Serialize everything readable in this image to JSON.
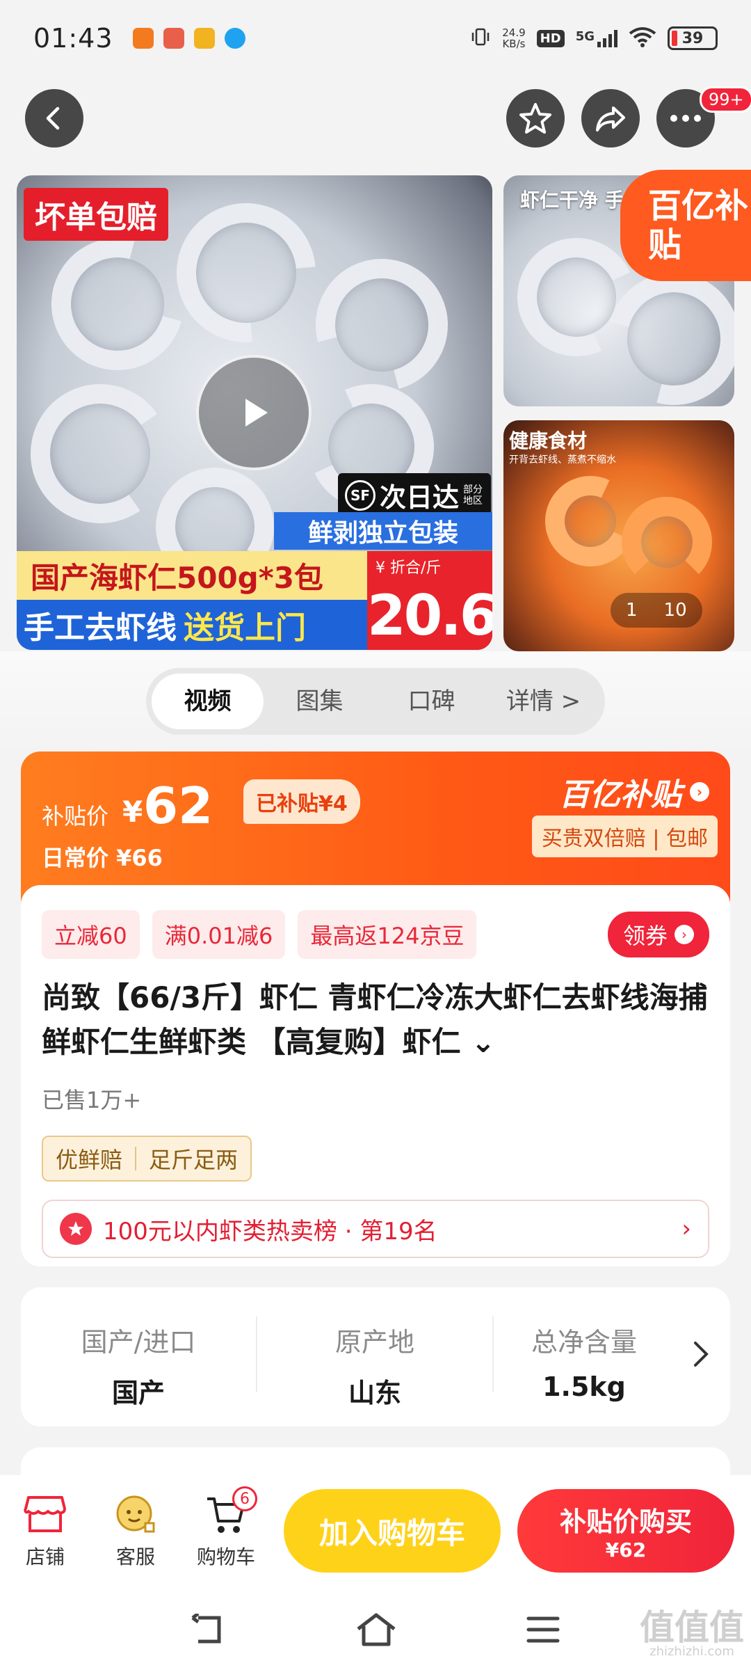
{
  "status_bar": {
    "time": "01:43",
    "speed_value": "24.9",
    "speed_unit": "KB/s",
    "hd": "HD",
    "network": "5G",
    "battery": "39"
  },
  "top_nav": {
    "more_badge": "99+"
  },
  "gallery": {
    "main": {
      "tag": "坏单包赔",
      "sf_label": "次日达",
      "sf_note": "部分地区",
      "blue_banner": "鲜剥独立包装",
      "yellow_banner": "国产海虾仁500g*3包",
      "blue_banner2_a": "手工去虾线",
      "blue_banner2_b": "送货上门",
      "price_label": "¥    折合/斤",
      "price_value": "20.6"
    },
    "top_thumb": {
      "caption": "虾仁干净 手"
    },
    "subsidy_badge": "百亿补贴",
    "bottom_thumb": {
      "caption": "健康食材",
      "caption2": "开背去虾线、蒸煮不缩水"
    },
    "pager_current": "1",
    "pager_total": "10"
  },
  "tabs": [
    {
      "label": "视频",
      "active": true
    },
    {
      "label": "图集",
      "active": false
    },
    {
      "label": "口碑",
      "active": false
    },
    {
      "label": "详情 >",
      "active": false
    }
  ],
  "price_card": {
    "label": "补贴价",
    "currency": "¥",
    "price": "62",
    "subsidized": "已补贴¥4",
    "daily_price": "日常价 ¥66",
    "logo": "百亿补贴",
    "guarantee": "买贵双倍赔 | 包邮"
  },
  "coupons": [
    "立减60",
    "满0.01减6",
    "最高返124京豆"
  ],
  "get_coupon": "领券",
  "title": "尚致【66/3斤】虾仁 青虾仁冷冻大虾仁去虾线海捕鲜虾仁生鲜虾类 【高复购】虾仁 ⌄",
  "sold": "已售1万+",
  "service_tags": [
    "优鲜赔",
    "足斤足两"
  ],
  "ranking": {
    "text": "100元以内虾类热卖榜 · 第19名",
    "arrow": "›"
  },
  "params": [
    {
      "key": "国产/进口",
      "value": "国产"
    },
    {
      "key": "原产地",
      "value": "山东"
    },
    {
      "key": "总净含量",
      "value": "1.5kg"
    }
  ],
  "bottom_bar": {
    "shop": "店铺",
    "service": "客服",
    "cart": "购物车",
    "cart_count": "6",
    "add_cart": "加入购物车",
    "buy_label": "补贴价购买",
    "buy_price": "¥62"
  },
  "watermark": {
    "main": "值值值",
    "sub": "zhizhizhi.com"
  },
  "colors": {
    "accent_red": "#f0243a",
    "subsidy_orange": "#ff5a15",
    "cart_yellow": "#ffd21a"
  }
}
